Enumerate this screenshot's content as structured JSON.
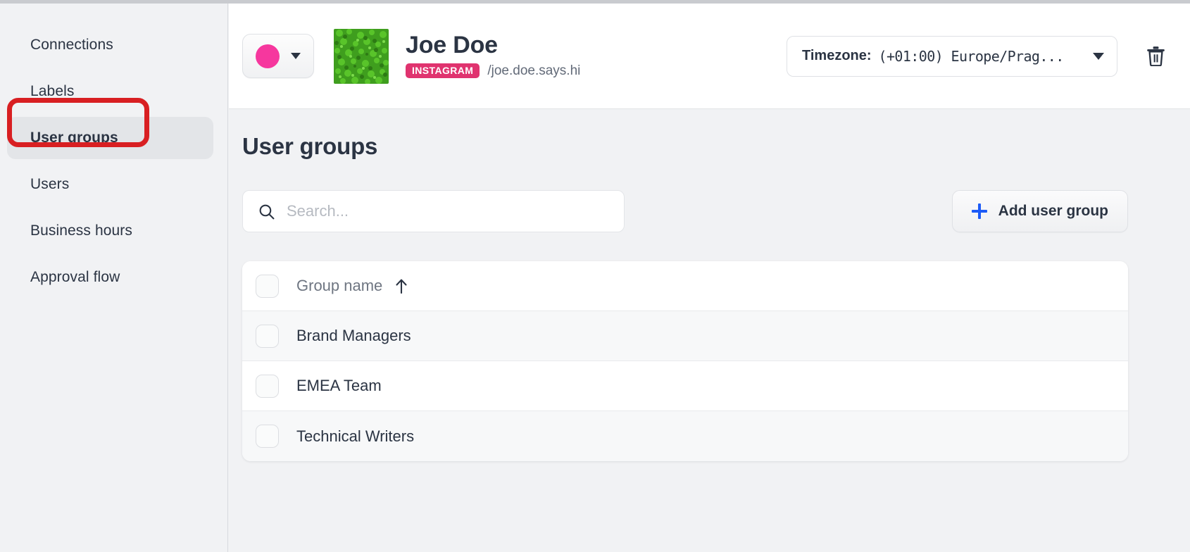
{
  "sidebar": {
    "items": [
      {
        "label": "Connections",
        "active": false
      },
      {
        "label": "Labels",
        "active": false
      },
      {
        "label": "User groups",
        "active": true
      },
      {
        "label": "Users",
        "active": false
      },
      {
        "label": "Business hours",
        "active": false
      },
      {
        "label": "Approval flow",
        "active": false
      }
    ]
  },
  "header": {
    "color_swatch": "#f6379e",
    "person_name": "Joe Doe",
    "platform_badge": "INSTAGRAM",
    "handle": "/joe.doe.says.hi",
    "timezone_label": "Timezone:",
    "timezone_value": "(+01:00) Europe/Prag...",
    "delete_icon": "trash-icon"
  },
  "main": {
    "title": "User groups",
    "search_placeholder": "Search...",
    "search_value": "",
    "add_button_label": "Add user group",
    "table": {
      "columns": [
        "Group name"
      ],
      "sort_column": "Group name",
      "sort_direction": "ascending",
      "rows": [
        {
          "name": "Brand Managers",
          "selected": false
        },
        {
          "name": "EMEA Team",
          "selected": false
        },
        {
          "name": "Technical Writers",
          "selected": false
        }
      ]
    }
  },
  "annotation": {
    "color": "#d81f22",
    "target": "User groups"
  },
  "colors": {
    "accent_blue": "#1d5bf7",
    "badge_pink": "#e0336f",
    "swatch_pink": "#f6379e",
    "text_dark": "#2b3443",
    "page_bg": "#f1f2f4"
  }
}
